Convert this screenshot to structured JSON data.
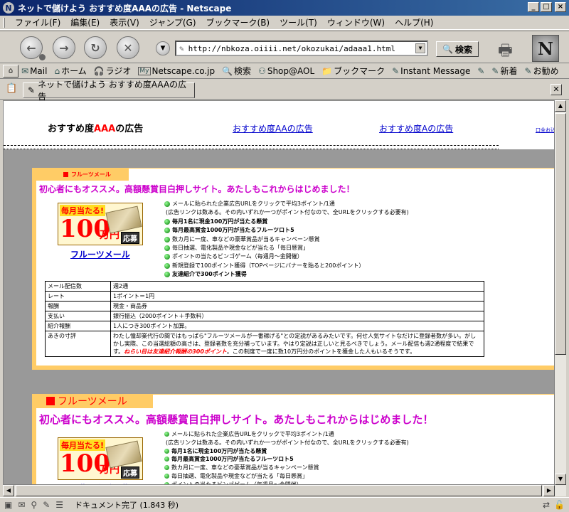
{
  "window": {
    "title": "ネットで儲けよう おすすめ度AAAの広告 - Netscape",
    "app_icon": "N",
    "controls": [
      "_",
      "□",
      "×"
    ]
  },
  "menu": [
    "ファイル(F)",
    "編集(E)",
    "表示(V)",
    "ジャンプ(G)",
    "ブックマーク(B)",
    "ツール(T)",
    "ウィンドウ(W)",
    "ヘルプ(H)"
  ],
  "nav": {
    "back_icon": "back-arrow-icon",
    "forward_icon": "forward-arrow-icon",
    "reload_icon": "reload-icon",
    "stop_icon": "stop-icon",
    "url": "http://nbkoza.oiiii.net/okozukai/adaaa1.html",
    "search_label": "検索",
    "logo": "N"
  },
  "personal_bar": [
    {
      "icon": "mail-icon",
      "glyph": "✉",
      "label": "Mail"
    },
    {
      "icon": "home-icon",
      "glyph": "⌂",
      "label": "ホーム"
    },
    {
      "icon": "radio-icon",
      "glyph": "🎧",
      "label": "ラジオ"
    },
    {
      "icon": "netscape-icon",
      "glyph": "My",
      "label": "Netscape.co.jp"
    },
    {
      "icon": "search-icon",
      "glyph": "🔍",
      "label": "検索"
    },
    {
      "icon": "aol-icon",
      "glyph": "⚇",
      "label": "Shop@AOL"
    },
    {
      "icon": "bookmark-icon",
      "glyph": "📁",
      "label": "ブックマーク"
    },
    {
      "icon": "bookmark-icon",
      "glyph": "✎",
      "label": "Instant Message"
    },
    {
      "icon": "bookmark-icon",
      "glyph": "✎",
      "label": ""
    },
    {
      "icon": "bookmark-icon",
      "glyph": "✎",
      "label": "新着"
    },
    {
      "icon": "bookmark-icon",
      "glyph": "✎",
      "label": "お勧め"
    }
  ],
  "tab": {
    "label": "ネットで儲けよう おすすめ度AAAの広告"
  },
  "page": {
    "title_prefix": "おすすめ度",
    "title_red": "AAA",
    "title_suffix": "の広告",
    "links": [
      "おすすめ度AAの広告",
      "おすすめ度Aの広告"
    ],
    "tiny_link": "口全お込",
    "ad": {
      "tab_label": "フルーツメール",
      "heading": "初心者にもオススメ。高額懸賞目白押しサイト。あたしもこれからはじめました！",
      "banner": {
        "top": "毎月当たる!",
        "big": "100",
        "yen": "万円",
        "stamp": "応募"
      },
      "link": "フルーツメール",
      "bullets": [
        {
          "text": "メールに貼られた企業広告URLをクリックで平均3ポイント/1通",
          "bold": false
        },
        {
          "text": "(広告リンクは数ある。その内いずれか一つがポイント付なので、全URLをクリックする必要有)",
          "bold": false,
          "sub": true
        },
        {
          "text": "毎月1名に現金100万円が当たる懸賞",
          "bold": true
        },
        {
          "text": "毎月最高賞金1000万円が当たるフルーツロト5",
          "bold": true
        },
        {
          "text": "数カ月に一度、車などの豪華賞品が当るキャンペーン懸賞",
          "bold": false
        },
        {
          "text": "毎日抽選、電化製品や現金などが当たる「毎日懸賞」",
          "bold": false
        },
        {
          "text": "ポイントの当たるビンゴゲーム（毎週月～金開催）",
          "bold": false
        },
        {
          "text": "新規登録で100ポイント獲得（TOPページにバナーを貼ると200ポイント）",
          "bold": false
        },
        {
          "text": "友達紹介で300ポイント獲得",
          "bold": true
        }
      ],
      "table": [
        {
          "k": "メール配信数",
          "v": "週2通"
        },
        {
          "k": "レート",
          "v": "1ポイント＝1円"
        },
        {
          "k": "報酬",
          "v": "現金・商品券"
        },
        {
          "k": "支払い",
          "v": "銀行振込（2000ポイント＋手数料）"
        },
        {
          "k": "紹介報酬",
          "v": "1人につき300ポイント加算。"
        }
      ],
      "note_key": "あきの寸評",
      "note_1": "わたし憧却業代行の間ではもっぱら\"フルーツメールが一番稼げる\"との定説があるみたいです。何せ人気サイトなだけに登録者数が多い。がしかし実際、この当選総額の高さは、登録者数を充分補っています。やはり定説は正しいと見るべきでしょう。メール配信も週2通程度で結果です。",
      "note_red": "ねらい目は友達紹介報酬の300ポイント",
      "note_2": "。この制度で一度に数10万円分のポイントを獲金した人もいるそうです。"
    }
  },
  "status": {
    "text": "ドキュメント完了 (1.843 秒)"
  }
}
